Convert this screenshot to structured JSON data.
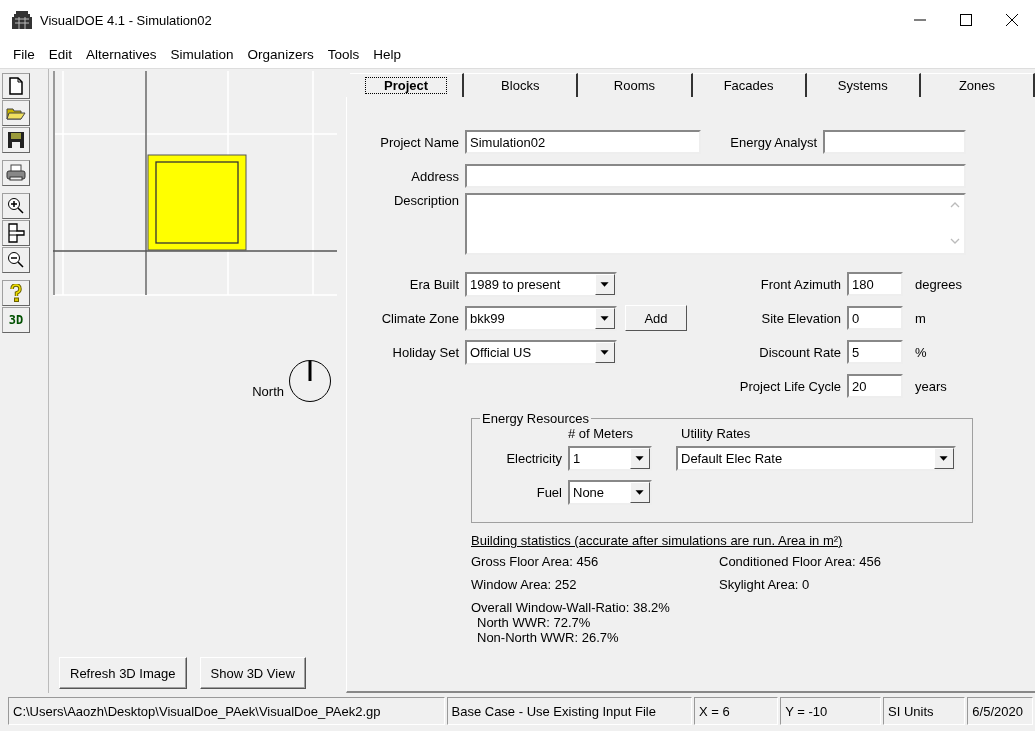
{
  "window": {
    "title": "VisualDOE 4.1 - Simulation02"
  },
  "menu": [
    "File",
    "Edit",
    "Alternatives",
    "Simulation",
    "Organizers",
    "Tools",
    "Help"
  ],
  "toolbar": [
    {
      "kind": "new"
    },
    {
      "kind": "open"
    },
    {
      "kind": "save"
    },
    {
      "kind": "print"
    },
    {
      "kind": "zoom-in"
    },
    {
      "kind": "fit"
    },
    {
      "kind": "zoom-out"
    },
    {
      "kind": "help"
    },
    {
      "kind": "text",
      "label": "3D"
    }
  ],
  "plan_view": {
    "north_label": "North",
    "buttons": [
      "Refresh 3D Image",
      "Show 3D View"
    ]
  },
  "tabs": [
    {
      "label": "Project",
      "selected": true
    },
    {
      "label": "Blocks",
      "selected": false
    },
    {
      "label": "Rooms",
      "selected": false
    },
    {
      "label": "Facades",
      "selected": false
    },
    {
      "label": "Systems",
      "selected": false
    },
    {
      "label": "Zones",
      "selected": false
    }
  ],
  "project": {
    "project_name": {
      "label": "Project Name",
      "value": "Simulation02"
    },
    "energy_analyst": {
      "label": "Energy Analyst"
    },
    "address": {
      "label": "Address"
    },
    "description": {
      "label": "Description"
    },
    "selects": [
      {
        "label": "Era Built",
        "value": "1989 to present"
      },
      {
        "label": "Climate Zone",
        "value": "bkk99",
        "button": "Add"
      },
      {
        "label": "Holiday Set",
        "value": "Official US"
      }
    ],
    "numbers": [
      {
        "label": "Front Azimuth",
        "value": "180",
        "unit": "degrees"
      },
      {
        "label": "Site Elevation",
        "value": "0",
        "unit": "m"
      },
      {
        "label": "Discount Rate",
        "value": "5",
        "unit": "%"
      },
      {
        "label": "Project Life Cycle",
        "value": "20",
        "unit": "years"
      }
    ],
    "energy_resources": {
      "title": "Energy Resources",
      "meters_heading": "# of Meters",
      "rates_heading": "Utility Rates",
      "rows": [
        {
          "label": "Electricity",
          "meters": "1",
          "rate": "Default Elec Rate"
        },
        {
          "label": "Fuel",
          "meters": "None"
        }
      ]
    },
    "statistics": {
      "heading": "Building statistics (accurate after simulations are run. Area in m²)",
      "gross_floor_area": "Gross Floor Area: 456",
      "conditioned_floor_area": "Conditioned Floor Area: 456",
      "window_area": "Window Area: 252",
      "skylight_area": "Skylight Area: 0",
      "wwr": [
        "Overall Window-Wall-Ratio: 38.2%",
        "North WWR: 72.7%",
        "Non-North WWR: 26.7%"
      ]
    }
  },
  "status_bar": [
    "C:\\Users\\Aaozh\\Desktop\\VisualDoe_PAek\\VisualDoe_PAek2.gp",
    "Base Case - Use Existing Input File",
    "X = 6",
    "Y = -10",
    "SI Units",
    "6/5/2020"
  ]
}
